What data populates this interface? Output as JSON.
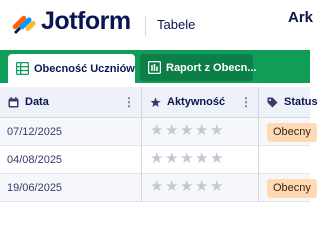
{
  "header": {
    "brand": "Jotform",
    "product": "Tabele",
    "right_title": "Ark"
  },
  "tabs": [
    {
      "label": "Obecność Uczniów",
      "icon": "table-grid-icon",
      "active": true
    },
    {
      "label": "Raport z Obecn...",
      "icon": "report-icon",
      "active": false
    }
  ],
  "columns": [
    {
      "label": "Data",
      "icon": "calendar-icon"
    },
    {
      "label": "Aktywność",
      "icon": "star-icon"
    },
    {
      "label": "Status",
      "icon": "tag-icon"
    }
  ],
  "rows": [
    {
      "date": "07/12/2025",
      "rating": 0,
      "status": "Obecny"
    },
    {
      "date": "04/08/2025",
      "rating": 0,
      "status": ""
    },
    {
      "date": "19/06/2025",
      "rating": 0,
      "status": "Obecny"
    }
  ],
  "colors": {
    "tab_bar": "#0f9d58",
    "brand_text": "#0a1551",
    "status_badge": "#ffd9b3"
  }
}
